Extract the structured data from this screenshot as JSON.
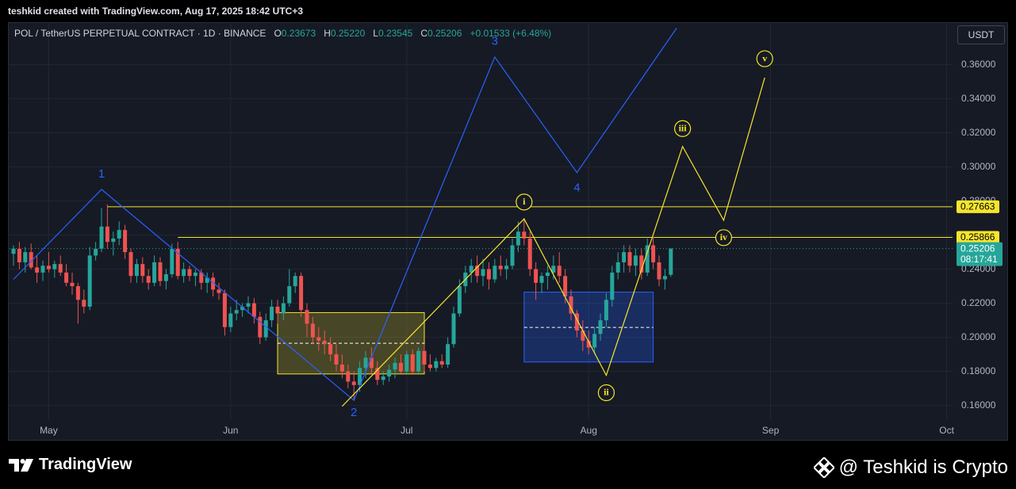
{
  "header": {
    "attribution": "teshkid created with TradingView.com, Aug 17, 2025 18:42 UTC+3"
  },
  "legend": {
    "symbol": "POL / TetherUS PERPETUAL CONTRACT · 1D · BINANCE",
    "o_label": "O",
    "o_value": "0.23673",
    "h_label": "H",
    "h_value": "0.25220",
    "l_label": "L",
    "l_value": "0.23545",
    "c_label": "C",
    "c_value": "0.25206",
    "change": "+0.01533 (+6.48%)"
  },
  "currency": "USDT",
  "footer": {
    "logo_text": "TradingView",
    "watermark": "@ Teshkid is Crypto"
  },
  "colors": {
    "background": "#161a25",
    "grid": "#232734",
    "up": "#26a69a",
    "down": "#ef5350",
    "wave_blue": "#2962ff",
    "wave_yellow": "#f5e52c",
    "text": "#d1d4dc"
  },
  "chart_data": {
    "type": "candlestick",
    "y_axis": {
      "min": 0.152,
      "max": 0.3815,
      "ticks": [
        "0.16000",
        "0.18000",
        "0.20000",
        "0.22000",
        "0.24000",
        "0.26000",
        "0.28000",
        "0.30000",
        "0.32000",
        "0.34000",
        "0.36000"
      ]
    },
    "x_axis": {
      "start_date": "2025-04-25",
      "end_date": "2025-10-03",
      "ticks": [
        {
          "label": "May",
          "day": 6
        },
        {
          "label": "Jun",
          "day": 37
        },
        {
          "label": "Jul",
          "day": 67
        },
        {
          "label": "Aug",
          "day": 98
        },
        {
          "label": "Sep",
          "day": 129
        },
        {
          "label": "Oct",
          "day": 159
        }
      ]
    },
    "price_labels": [
      {
        "value": "0.27663",
        "price": 0.27663,
        "kind": "level"
      },
      {
        "value": "0.25866",
        "price": 0.25866,
        "kind": "level"
      },
      {
        "value": "0.25206",
        "price": 0.25206,
        "kind": "current",
        "countdown": "08:17:41"
      }
    ],
    "horizontal_levels": [
      {
        "price": 0.27663,
        "from_day": 16
      },
      {
        "price": 0.25866,
        "from_day": 28
      }
    ],
    "boxes": [
      {
        "name": "demand-box-yellow",
        "day_from": 45,
        "day_to": 70,
        "price_low": 0.1785,
        "price_high": 0.2145,
        "mid": 0.1965
      },
      {
        "name": "demand-box-blue",
        "day_from": 87,
        "day_to": 109,
        "price_low": 0.1855,
        "price_high": 0.2265,
        "mid": 0.2058
      }
    ],
    "waves_blue": {
      "points": [
        {
          "day": 0,
          "price": 0.234
        },
        {
          "day": 15,
          "price": 0.2868
        },
        {
          "day": 58,
          "price": 0.163
        },
        {
          "day": 82,
          "price": 0.3645
        },
        {
          "day": 96,
          "price": 0.2967
        },
        {
          "day": 113,
          "price": 0.3815
        }
      ],
      "labels": [
        {
          "text": "1",
          "day": 15,
          "price": 0.2955
        },
        {
          "text": "2",
          "day": 58,
          "price": 0.1555
        },
        {
          "text": "3",
          "day": 82,
          "price": 0.3735
        },
        {
          "text": "4",
          "day": 96,
          "price": 0.2875
        }
      ]
    },
    "waves_yellow": {
      "points": [
        {
          "day": 56,
          "price": 0.1595
        },
        {
          "day": 87,
          "price": 0.2695
        },
        {
          "day": 101,
          "price": 0.1777
        },
        {
          "day": 114,
          "price": 0.312
        },
        {
          "day": 121,
          "price": 0.2687
        },
        {
          "day": 128,
          "price": 0.3524
        }
      ],
      "labels": [
        {
          "text": "i",
          "day": 87,
          "price": 0.2794
        },
        {
          "text": "ii",
          "day": 101,
          "price": 0.1675
        },
        {
          "text": "iii",
          "day": 114,
          "price": 0.3225
        },
        {
          "text": "iv",
          "day": 121,
          "price": 0.2585
        },
        {
          "text": "v",
          "day": 128,
          "price": 0.3635
        }
      ]
    },
    "candles": [
      {
        "day": 0,
        "o": 0.249,
        "h": 0.254,
        "l": 0.242,
        "c": 0.252
      },
      {
        "day": 1,
        "o": 0.252,
        "h": 0.256,
        "l": 0.24,
        "c": 0.244
      },
      {
        "day": 2,
        "o": 0.244,
        "h": 0.253,
        "l": 0.238,
        "c": 0.25
      },
      {
        "day": 3,
        "o": 0.25,
        "h": 0.255,
        "l": 0.24,
        "c": 0.241
      },
      {
        "day": 4,
        "o": 0.241,
        "h": 0.248,
        "l": 0.232,
        "c": 0.238
      },
      {
        "day": 5,
        "o": 0.238,
        "h": 0.245,
        "l": 0.233,
        "c": 0.242
      },
      {
        "day": 6,
        "o": 0.242,
        "h": 0.25,
        "l": 0.238,
        "c": 0.24
      },
      {
        "day": 7,
        "o": 0.24,
        "h": 0.245,
        "l": 0.235,
        "c": 0.243
      },
      {
        "day": 8,
        "o": 0.243,
        "h": 0.248,
        "l": 0.236,
        "c": 0.238
      },
      {
        "day": 9,
        "o": 0.238,
        "h": 0.243,
        "l": 0.23,
        "c": 0.232
      },
      {
        "day": 10,
        "o": 0.232,
        "h": 0.238,
        "l": 0.225,
        "c": 0.23
      },
      {
        "day": 11,
        "o": 0.23,
        "h": 0.232,
        "l": 0.208,
        "c": 0.222
      },
      {
        "day": 12,
        "o": 0.222,
        "h": 0.228,
        "l": 0.214,
        "c": 0.218
      },
      {
        "day": 13,
        "o": 0.218,
        "h": 0.253,
        "l": 0.216,
        "c": 0.248
      },
      {
        "day": 14,
        "o": 0.248,
        "h": 0.256,
        "l": 0.245,
        "c": 0.252
      },
      {
        "day": 15,
        "o": 0.252,
        "h": 0.276,
        "l": 0.25,
        "c": 0.265
      },
      {
        "day": 16,
        "o": 0.265,
        "h": 0.278,
        "l": 0.252,
        "c": 0.256
      },
      {
        "day": 17,
        "o": 0.256,
        "h": 0.262,
        "l": 0.248,
        "c": 0.258
      },
      {
        "day": 18,
        "o": 0.258,
        "h": 0.268,
        "l": 0.254,
        "c": 0.263
      },
      {
        "day": 19,
        "o": 0.263,
        "h": 0.266,
        "l": 0.246,
        "c": 0.25
      },
      {
        "day": 20,
        "o": 0.25,
        "h": 0.252,
        "l": 0.232,
        "c": 0.236
      },
      {
        "day": 21,
        "o": 0.236,
        "h": 0.246,
        "l": 0.232,
        "c": 0.243
      },
      {
        "day": 22,
        "o": 0.243,
        "h": 0.247,
        "l": 0.232,
        "c": 0.236
      },
      {
        "day": 23,
        "o": 0.236,
        "h": 0.24,
        "l": 0.228,
        "c": 0.232
      },
      {
        "day": 24,
        "o": 0.232,
        "h": 0.248,
        "l": 0.23,
        "c": 0.244
      },
      {
        "day": 25,
        "o": 0.244,
        "h": 0.247,
        "l": 0.23,
        "c": 0.233
      },
      {
        "day": 26,
        "o": 0.233,
        "h": 0.24,
        "l": 0.228,
        "c": 0.237
      },
      {
        "day": 27,
        "o": 0.237,
        "h": 0.255,
        "l": 0.235,
        "c": 0.252
      },
      {
        "day": 28,
        "o": 0.252,
        "h": 0.256,
        "l": 0.234,
        "c": 0.236
      },
      {
        "day": 29,
        "o": 0.236,
        "h": 0.244,
        "l": 0.232,
        "c": 0.24
      },
      {
        "day": 30,
        "o": 0.24,
        "h": 0.242,
        "l": 0.233,
        "c": 0.236
      },
      {
        "day": 31,
        "o": 0.236,
        "h": 0.24,
        "l": 0.23,
        "c": 0.238
      },
      {
        "day": 32,
        "o": 0.238,
        "h": 0.24,
        "l": 0.228,
        "c": 0.232
      },
      {
        "day": 33,
        "o": 0.232,
        "h": 0.238,
        "l": 0.226,
        "c": 0.235
      },
      {
        "day": 34,
        "o": 0.235,
        "h": 0.238,
        "l": 0.224,
        "c": 0.228
      },
      {
        "day": 35,
        "o": 0.228,
        "h": 0.232,
        "l": 0.222,
        "c": 0.226
      },
      {
        "day": 36,
        "o": 0.226,
        "h": 0.228,
        "l": 0.201,
        "c": 0.206
      },
      {
        "day": 37,
        "o": 0.206,
        "h": 0.218,
        "l": 0.203,
        "c": 0.214
      },
      {
        "day": 38,
        "o": 0.214,
        "h": 0.222,
        "l": 0.21,
        "c": 0.216
      },
      {
        "day": 39,
        "o": 0.216,
        "h": 0.22,
        "l": 0.212,
        "c": 0.218
      },
      {
        "day": 40,
        "o": 0.218,
        "h": 0.224,
        "l": 0.214,
        "c": 0.22
      },
      {
        "day": 41,
        "o": 0.22,
        "h": 0.223,
        "l": 0.208,
        "c": 0.212
      },
      {
        "day": 42,
        "o": 0.212,
        "h": 0.215,
        "l": 0.196,
        "c": 0.2
      },
      {
        "day": 43,
        "o": 0.2,
        "h": 0.214,
        "l": 0.198,
        "c": 0.21
      },
      {
        "day": 44,
        "o": 0.21,
        "h": 0.222,
        "l": 0.206,
        "c": 0.218
      },
      {
        "day": 45,
        "o": 0.218,
        "h": 0.222,
        "l": 0.208,
        "c": 0.214
      },
      {
        "day": 46,
        "o": 0.214,
        "h": 0.224,
        "l": 0.21,
        "c": 0.22
      },
      {
        "day": 47,
        "o": 0.22,
        "h": 0.24,
        "l": 0.218,
        "c": 0.23
      },
      {
        "day": 48,
        "o": 0.23,
        "h": 0.238,
        "l": 0.226,
        "c": 0.236
      },
      {
        "day": 49,
        "o": 0.236,
        "h": 0.238,
        "l": 0.212,
        "c": 0.216
      },
      {
        "day": 50,
        "o": 0.216,
        "h": 0.22,
        "l": 0.2,
        "c": 0.208
      },
      {
        "day": 51,
        "o": 0.208,
        "h": 0.212,
        "l": 0.196,
        "c": 0.2
      },
      {
        "day": 52,
        "o": 0.2,
        "h": 0.206,
        "l": 0.192,
        "c": 0.198
      },
      {
        "day": 53,
        "o": 0.198,
        "h": 0.204,
        "l": 0.19,
        "c": 0.196
      },
      {
        "day": 54,
        "o": 0.196,
        "h": 0.2,
        "l": 0.186,
        "c": 0.19
      },
      {
        "day": 55,
        "o": 0.19,
        "h": 0.196,
        "l": 0.18,
        "c": 0.184
      },
      {
        "day": 56,
        "o": 0.184,
        "h": 0.19,
        "l": 0.176,
        "c": 0.18
      },
      {
        "day": 57,
        "o": 0.18,
        "h": 0.184,
        "l": 0.17,
        "c": 0.174
      },
      {
        "day": 58,
        "o": 0.174,
        "h": 0.18,
        "l": 0.163,
        "c": 0.172
      },
      {
        "day": 59,
        "o": 0.172,
        "h": 0.186,
        "l": 0.168,
        "c": 0.182
      },
      {
        "day": 60,
        "o": 0.182,
        "h": 0.192,
        "l": 0.176,
        "c": 0.188
      },
      {
        "day": 61,
        "o": 0.188,
        "h": 0.194,
        "l": 0.178,
        "c": 0.182
      },
      {
        "day": 62,
        "o": 0.182,
        "h": 0.186,
        "l": 0.172,
        "c": 0.175
      },
      {
        "day": 63,
        "o": 0.175,
        "h": 0.18,
        "l": 0.172,
        "c": 0.177
      },
      {
        "day": 64,
        "o": 0.177,
        "h": 0.184,
        "l": 0.174,
        "c": 0.181
      },
      {
        "day": 65,
        "o": 0.181,
        "h": 0.188,
        "l": 0.176,
        "c": 0.185
      },
      {
        "day": 66,
        "o": 0.185,
        "h": 0.19,
        "l": 0.178,
        "c": 0.18
      },
      {
        "day": 67,
        "o": 0.18,
        "h": 0.192,
        "l": 0.178,
        "c": 0.19
      },
      {
        "day": 68,
        "o": 0.19,
        "h": 0.193,
        "l": 0.178,
        "c": 0.18
      },
      {
        "day": 69,
        "o": 0.18,
        "h": 0.194,
        "l": 0.178,
        "c": 0.192
      },
      {
        "day": 70,
        "o": 0.192,
        "h": 0.196,
        "l": 0.18,
        "c": 0.184
      },
      {
        "day": 71,
        "o": 0.184,
        "h": 0.19,
        "l": 0.18,
        "c": 0.182
      },
      {
        "day": 72,
        "o": 0.182,
        "h": 0.188,
        "l": 0.18,
        "c": 0.186
      },
      {
        "day": 73,
        "o": 0.186,
        "h": 0.19,
        "l": 0.182,
        "c": 0.184
      },
      {
        "day": 74,
        "o": 0.184,
        "h": 0.2,
        "l": 0.182,
        "c": 0.196
      },
      {
        "day": 75,
        "o": 0.196,
        "h": 0.218,
        "l": 0.194,
        "c": 0.214
      },
      {
        "day": 76,
        "o": 0.214,
        "h": 0.234,
        "l": 0.212,
        "c": 0.23
      },
      {
        "day": 77,
        "o": 0.23,
        "h": 0.242,
        "l": 0.226,
        "c": 0.238
      },
      {
        "day": 78,
        "o": 0.238,
        "h": 0.246,
        "l": 0.232,
        "c": 0.242
      },
      {
        "day": 79,
        "o": 0.242,
        "h": 0.248,
        "l": 0.232,
        "c": 0.236
      },
      {
        "day": 80,
        "o": 0.236,
        "h": 0.246,
        "l": 0.23,
        "c": 0.24
      },
      {
        "day": 81,
        "o": 0.24,
        "h": 0.244,
        "l": 0.228,
        "c": 0.234
      },
      {
        "day": 82,
        "o": 0.234,
        "h": 0.246,
        "l": 0.232,
        "c": 0.242
      },
      {
        "day": 83,
        "o": 0.242,
        "h": 0.248,
        "l": 0.236,
        "c": 0.24
      },
      {
        "day": 84,
        "o": 0.24,
        "h": 0.246,
        "l": 0.234,
        "c": 0.242
      },
      {
        "day": 85,
        "o": 0.242,
        "h": 0.258,
        "l": 0.24,
        "c": 0.254
      },
      {
        "day": 86,
        "o": 0.254,
        "h": 0.268,
        "l": 0.25,
        "c": 0.262
      },
      {
        "day": 87,
        "o": 0.262,
        "h": 0.27,
        "l": 0.254,
        "c": 0.258
      },
      {
        "day": 88,
        "o": 0.258,
        "h": 0.262,
        "l": 0.236,
        "c": 0.24
      },
      {
        "day": 89,
        "o": 0.24,
        "h": 0.244,
        "l": 0.222,
        "c": 0.232
      },
      {
        "day": 90,
        "o": 0.232,
        "h": 0.238,
        "l": 0.226,
        "c": 0.236
      },
      {
        "day": 91,
        "o": 0.236,
        "h": 0.242,
        "l": 0.228,
        "c": 0.238
      },
      {
        "day": 92,
        "o": 0.238,
        "h": 0.248,
        "l": 0.234,
        "c": 0.242
      },
      {
        "day": 93,
        "o": 0.242,
        "h": 0.25,
        "l": 0.232,
        "c": 0.236
      },
      {
        "day": 94,
        "o": 0.236,
        "h": 0.24,
        "l": 0.22,
        "c": 0.224
      },
      {
        "day": 95,
        "o": 0.224,
        "h": 0.228,
        "l": 0.21,
        "c": 0.214
      },
      {
        "day": 96,
        "o": 0.214,
        "h": 0.216,
        "l": 0.2,
        "c": 0.204
      },
      {
        "day": 97,
        "o": 0.204,
        "h": 0.21,
        "l": 0.192,
        "c": 0.198
      },
      {
        "day": 98,
        "o": 0.198,
        "h": 0.204,
        "l": 0.19,
        "c": 0.194
      },
      {
        "day": 99,
        "o": 0.194,
        "h": 0.206,
        "l": 0.19,
        "c": 0.202
      },
      {
        "day": 100,
        "o": 0.202,
        "h": 0.214,
        "l": 0.198,
        "c": 0.21
      },
      {
        "day": 101,
        "o": 0.21,
        "h": 0.226,
        "l": 0.206,
        "c": 0.222
      },
      {
        "day": 102,
        "o": 0.222,
        "h": 0.242,
        "l": 0.218,
        "c": 0.238
      },
      {
        "day": 103,
        "o": 0.238,
        "h": 0.25,
        "l": 0.234,
        "c": 0.244
      },
      {
        "day": 104,
        "o": 0.244,
        "h": 0.254,
        "l": 0.238,
        "c": 0.25
      },
      {
        "day": 105,
        "o": 0.25,
        "h": 0.254,
        "l": 0.238,
        "c": 0.242
      },
      {
        "day": 106,
        "o": 0.242,
        "h": 0.252,
        "l": 0.236,
        "c": 0.248
      },
      {
        "day": 107,
        "o": 0.248,
        "h": 0.252,
        "l": 0.234,
        "c": 0.238
      },
      {
        "day": 108,
        "o": 0.238,
        "h": 0.258,
        "l": 0.236,
        "c": 0.254
      },
      {
        "day": 109,
        "o": 0.254,
        "h": 0.259,
        "l": 0.24,
        "c": 0.244
      },
      {
        "day": 110,
        "o": 0.244,
        "h": 0.248,
        "l": 0.23,
        "c": 0.234
      },
      {
        "day": 111,
        "o": 0.234,
        "h": 0.24,
        "l": 0.228,
        "c": 0.236
      },
      {
        "day": 112,
        "o": 0.2367,
        "h": 0.2522,
        "l": 0.2355,
        "c": 0.2521
      }
    ]
  }
}
